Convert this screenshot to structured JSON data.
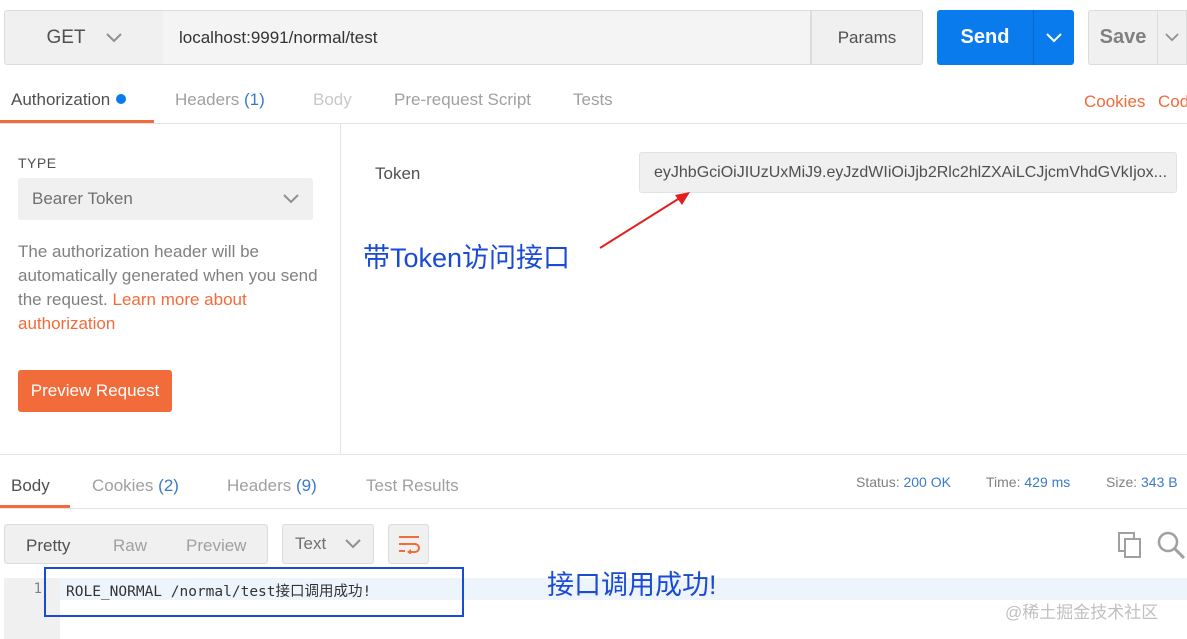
{
  "request": {
    "method": "GET",
    "url": "localhost:9991/normal/test",
    "params_label": "Params",
    "send_label": "Send",
    "save_label": "Save"
  },
  "request_tabs": {
    "authorization": "Authorization",
    "headers": "Headers",
    "headers_count": "(1)",
    "body": "Body",
    "pre_request": "Pre-request Script",
    "tests": "Tests",
    "cookies": "Cookies",
    "code": "Cod"
  },
  "auth": {
    "type_label": "TYPE",
    "type_value": "Bearer Token",
    "description": "The authorization header will be automatically generated when you send the request.",
    "learn_more": "Learn more about authorization",
    "preview_button": "Preview Request",
    "token_label": "Token",
    "token_value": "eyJhbGciOiJIUzUxMiJ9.eyJzdWIiOiJjb2Rlc2hlZXAiLCJjcmVhdGVkIjox..."
  },
  "annotations": {
    "token_note": "带Token访问接口",
    "success_note": "接口调用成功!"
  },
  "response_tabs": {
    "body": "Body",
    "cookies": "Cookies",
    "cookies_count": "(2)",
    "headers": "Headers",
    "headers_count": "(9)",
    "test_results": "Test Results"
  },
  "response_meta": {
    "status_label": "Status:",
    "status_value": "200 OK",
    "time_label": "Time:",
    "time_value": "429 ms",
    "size_label": "Size:",
    "size_value": "343 B"
  },
  "response_view": {
    "pretty": "Pretty",
    "raw": "Raw",
    "preview": "Preview",
    "format": "Text"
  },
  "response_body": {
    "line_number": "1",
    "content": "ROLE_NORMAL /normal/test接口调用成功!"
  },
  "watermark": "@稀土掘金技术社区",
  "colors": {
    "accent_orange": "#f26b3a",
    "send_blue": "#097bed",
    "link_blue": "#3a7ac9",
    "annotation_blue": "#1a4bd4",
    "arrow_red": "#e02020"
  }
}
